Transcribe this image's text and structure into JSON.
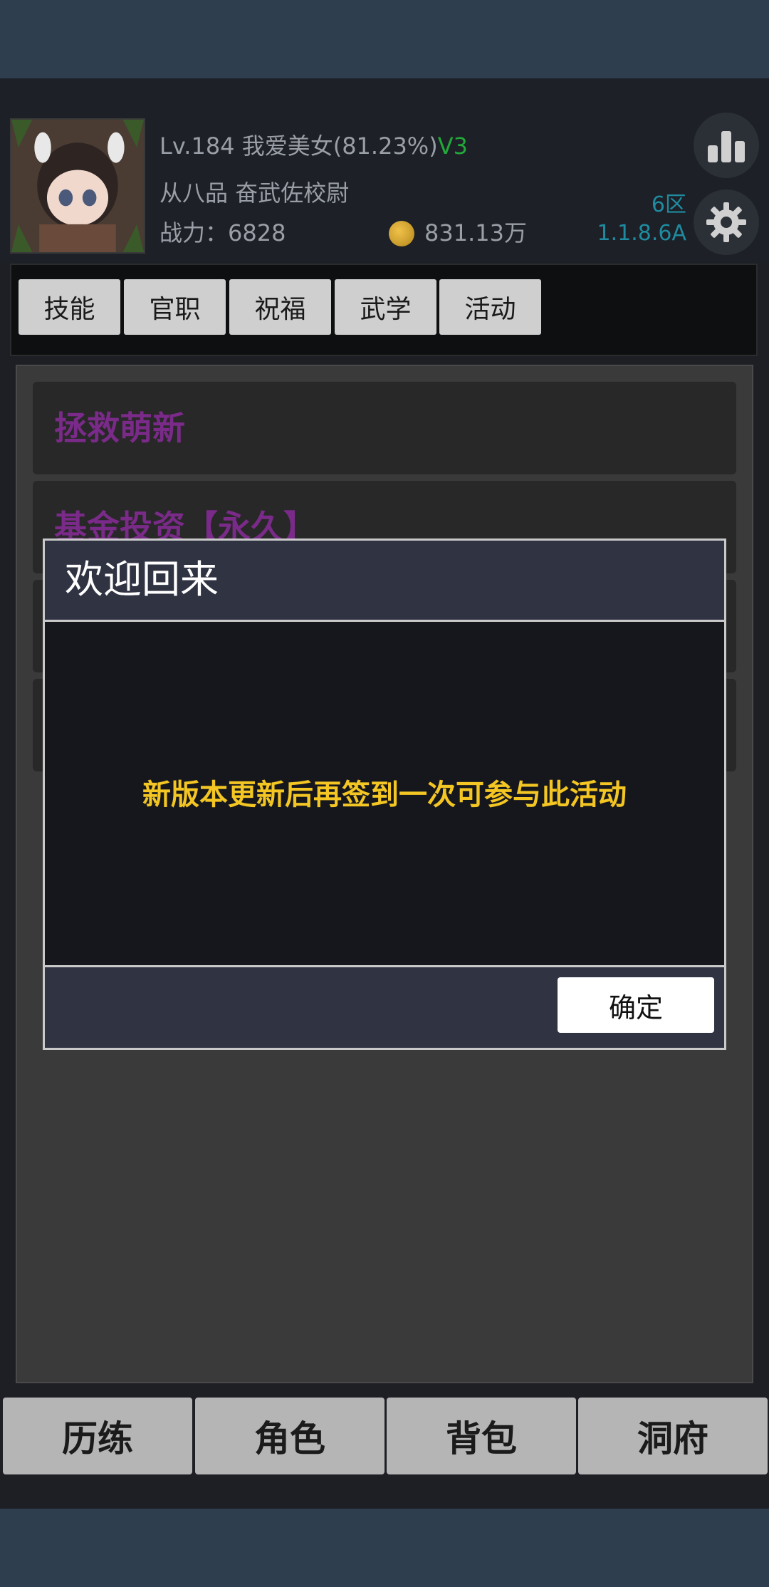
{
  "player": {
    "level_label": "Lv.184",
    "name": "我爱美女(81.23%)",
    "vip": "V3",
    "rank": "从八品",
    "title": "奋武佐校尉",
    "power_label": "战力：6828",
    "gold": "831.13万",
    "server": "6区",
    "version": "1.1.8.6A"
  },
  "tabs": [
    {
      "label": "技能"
    },
    {
      "label": "官职"
    },
    {
      "label": "祝福"
    },
    {
      "label": "武学"
    },
    {
      "label": "活动"
    }
  ],
  "list": [
    {
      "label": "拯救萌新"
    },
    {
      "label": "基金投资【永久】"
    },
    {
      "label": ""
    },
    {
      "label": ""
    }
  ],
  "dialog": {
    "title": "欢迎回来",
    "message": "新版本更新后再签到一次可参与此活动",
    "ok_label": "确定"
  },
  "bottom_nav": [
    {
      "label": "历练"
    },
    {
      "label": "角色"
    },
    {
      "label": "背包"
    },
    {
      "label": "洞府"
    }
  ],
  "colors": {
    "accent_purple": "#7a2a88",
    "vip_green": "#22a83a",
    "server_teal": "#1f8ba0",
    "message_yellow": "#f3c623"
  },
  "icons": {
    "stats": "bar-chart-icon",
    "settings": "gear-icon",
    "coin": "coin-icon"
  }
}
